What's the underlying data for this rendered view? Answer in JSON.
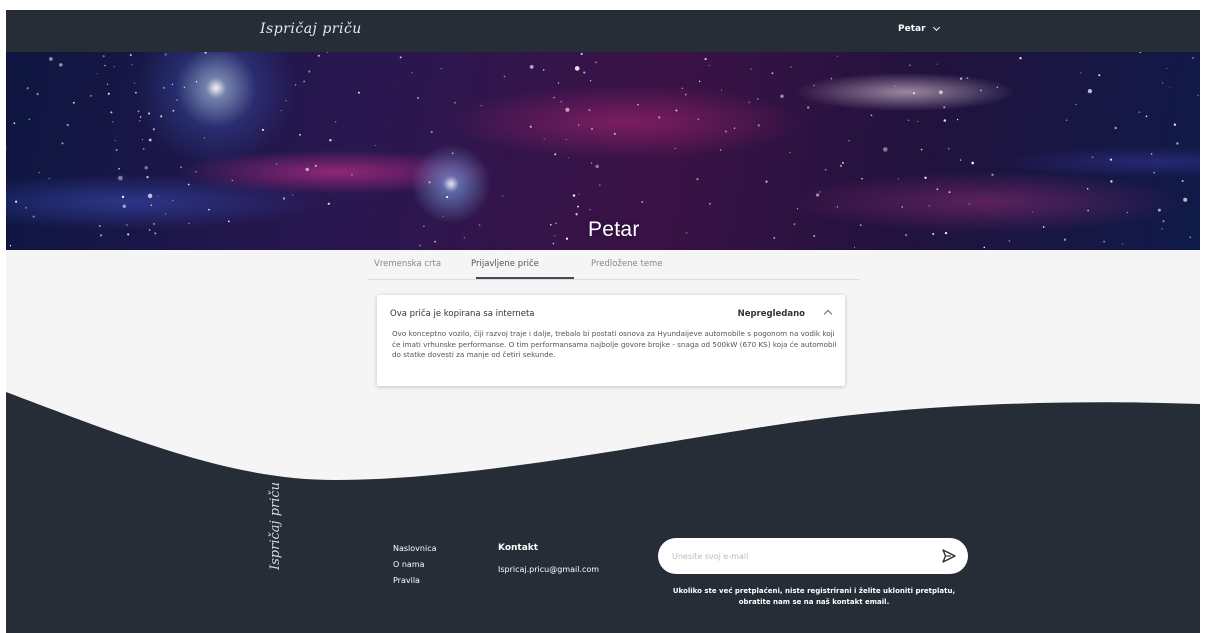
{
  "header": {
    "logo_text": "Ispričaj priču",
    "user_name": "Petar"
  },
  "hero": {
    "name": "Petar"
  },
  "tabs": [
    {
      "label": "Vremenska crta",
      "active": false
    },
    {
      "label": "Prijavljene priče",
      "active": true
    },
    {
      "label": "Predložene teme",
      "active": false
    }
  ],
  "report": {
    "title": "Ova priča je kopirana sa interneta",
    "status": "Nepregledano",
    "body": "Ovo konceptno vozilo, čiji razvoj traje i dalje, trebalo bi postati osnova za Hyundaijeve automobile s pogonom na vodik koji će imati vrhunske performanse. O tim performansama najbolje govore brojke - snaga od 500kW (670 KS) koja će automobil do statke dovesti za manje od četiri sekunde."
  },
  "footer": {
    "logo_text": "Ispričaj priču",
    "links": [
      "Naslovnica",
      "O nama",
      "Pravila"
    ],
    "contact_title": "Kontakt",
    "contact_email": "Ispricaj.pricu@gmail.com",
    "subscribe_placeholder": "Unesite svoj e-mail",
    "subscribe_note": "Ukoliko ste već pretplaćeni, niste registrirani i želite ukloniti pretplatu, obratite nam se na naš kontakt email."
  },
  "colors": {
    "dark": "#262d36",
    "page_bg": "#f5f5f5",
    "tab_indicator": "#454b59"
  }
}
